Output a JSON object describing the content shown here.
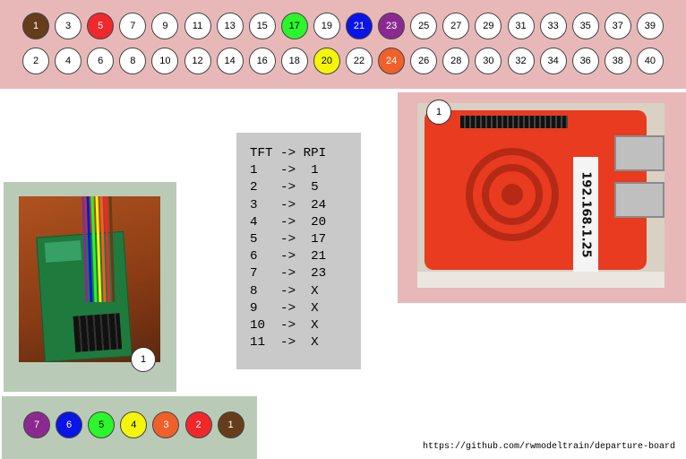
{
  "gpio_header": {
    "top_row": [
      {
        "label": "1",
        "color": "#653d1b"
      },
      {
        "label": "3",
        "color": "#ffffff"
      },
      {
        "label": "5",
        "color": "#f0272b"
      },
      {
        "label": "7",
        "color": "#ffffff"
      },
      {
        "label": "9",
        "color": "#ffffff"
      },
      {
        "label": "11",
        "color": "#ffffff"
      },
      {
        "label": "13",
        "color": "#ffffff"
      },
      {
        "label": "15",
        "color": "#ffffff"
      },
      {
        "label": "17",
        "color": "#2bf52b"
      },
      {
        "label": "19",
        "color": "#ffffff"
      },
      {
        "label": "21",
        "color": "#0a14e6"
      },
      {
        "label": "23",
        "color": "#8a2a91"
      },
      {
        "label": "25",
        "color": "#ffffff"
      },
      {
        "label": "27",
        "color": "#ffffff"
      },
      {
        "label": "29",
        "color": "#ffffff"
      },
      {
        "label": "31",
        "color": "#ffffff"
      },
      {
        "label": "33",
        "color": "#ffffff"
      },
      {
        "label": "35",
        "color": "#ffffff"
      },
      {
        "label": "37",
        "color": "#ffffff"
      },
      {
        "label": "39",
        "color": "#ffffff"
      }
    ],
    "bottom_row": [
      {
        "label": "2",
        "color": "#ffffff"
      },
      {
        "label": "4",
        "color": "#ffffff"
      },
      {
        "label": "6",
        "color": "#ffffff"
      },
      {
        "label": "8",
        "color": "#ffffff"
      },
      {
        "label": "10",
        "color": "#ffffff"
      },
      {
        "label": "12",
        "color": "#ffffff"
      },
      {
        "label": "14",
        "color": "#ffffff"
      },
      {
        "label": "16",
        "color": "#ffffff"
      },
      {
        "label": "18",
        "color": "#ffffff"
      },
      {
        "label": "20",
        "color": "#f5f50a"
      },
      {
        "label": "22",
        "color": "#ffffff"
      },
      {
        "label": "24",
        "color": "#f0602a"
      },
      {
        "label": "26",
        "color": "#ffffff"
      },
      {
        "label": "28",
        "color": "#ffffff"
      },
      {
        "label": "30",
        "color": "#ffffff"
      },
      {
        "label": "32",
        "color": "#ffffff"
      },
      {
        "label": "34",
        "color": "#ffffff"
      },
      {
        "label": "36",
        "color": "#ffffff"
      },
      {
        "label": "38",
        "color": "#ffffff"
      },
      {
        "label": "40",
        "color": "#ffffff"
      }
    ]
  },
  "mapping_table": {
    "header": "TFT -> RPI",
    "rows": [
      {
        "tft": "1",
        "rpi": "1"
      },
      {
        "tft": "2",
        "rpi": "5"
      },
      {
        "tft": "3",
        "rpi": "24"
      },
      {
        "tft": "4",
        "rpi": "20"
      },
      {
        "tft": "5",
        "rpi": "17"
      },
      {
        "tft": "6",
        "rpi": "21"
      },
      {
        "tft": "7",
        "rpi": "23"
      },
      {
        "tft": "8",
        "rpi": "X"
      },
      {
        "tft": "9",
        "rpi": "X"
      },
      {
        "tft": "10",
        "rpi": "X"
      },
      {
        "tft": "11",
        "rpi": "X"
      }
    ]
  },
  "wire_colors": [
    {
      "label": "7",
      "color": "#8a2a91"
    },
    {
      "label": "6",
      "color": "#0a14e6"
    },
    {
      "label": "5",
      "color": "#2bf52b"
    },
    {
      "label": "4",
      "color": "#f5f50a"
    },
    {
      "label": "3",
      "color": "#f0602a"
    },
    {
      "label": "2",
      "color": "#f0272b"
    },
    {
      "label": "1",
      "color": "#653d1b"
    }
  ],
  "tft_photo": {
    "callout": "1"
  },
  "rpi_photo": {
    "callout": "1",
    "ip_label": "192.168.1.25"
  },
  "footer": {
    "url": "https://github.com/rwmodeltrain/departure-board"
  },
  "colors": {
    "pink_panel": "#e8b8b9",
    "green_panel": "#b9cbb6",
    "grey_panel": "#c9c9c9"
  }
}
